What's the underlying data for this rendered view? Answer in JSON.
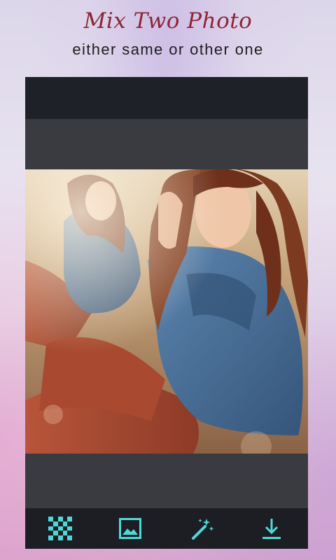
{
  "header": {
    "title": "Mix Two Photo",
    "subtitle": "either same or other one"
  },
  "toolbar": {
    "items": [
      {
        "name": "pattern-tool",
        "icon": "checkerboard-icon"
      },
      {
        "name": "gallery-tool",
        "icon": "image-icon"
      },
      {
        "name": "effects-tool",
        "icon": "magic-wand-icon"
      },
      {
        "name": "save-tool",
        "icon": "download-icon"
      }
    ]
  },
  "colors": {
    "accent": "#4fd8d8",
    "title": "#8e2434",
    "frame": "#1f2128",
    "band": "#3a3b40"
  }
}
